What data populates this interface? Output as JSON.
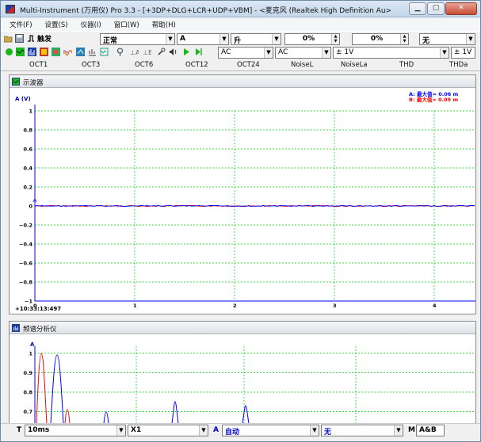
{
  "titlebar": {
    "title": "Multi-Instrument (万用仪) Pro 3.3   -   [+3DP+DLG+LCR+UDP+VBM]   -   <麦克风 (Realtek High Definition Au>"
  },
  "menu": [
    "文件(F)",
    "设置(S)",
    "仪器(I)",
    "窗口(W)",
    "帮助(H)"
  ],
  "toolbar1": {
    "trigger_label": "触发",
    "mode_value": "正常",
    "channel_value": "A",
    "edge_value": "升",
    "level_value": "0%",
    "position_value": "0%",
    "extra_value": "无"
  },
  "toolbar2": {
    "coupling_a": "AC",
    "coupling_b": "AC",
    "range_a": "± 1V",
    "range_b": "± 1V"
  },
  "octave_tabs": [
    "OCT1",
    "OCT3",
    "OCT6",
    "OCT12",
    "OCT24",
    "NoiseL",
    "NoiseLa",
    "THD",
    "THDa"
  ],
  "oscilloscope": {
    "title": "示波器",
    "y_axis_label": "A  (V)",
    "legend_a": "A:  最大值=     0.06  m",
    "legend_b": "B:  最大值=     0.09  m",
    "time_label": "+10:33:13:497",
    "y_ticks": [
      "1",
      "0.8",
      "0.6",
      "0.4",
      "0.2",
      "0",
      "−0.2",
      "−0.4",
      "−0.6",
      "−0.8",
      "−1"
    ],
    "x_ticks": [
      "0",
      "1",
      "2",
      "3",
      "4"
    ],
    "colors": {
      "grid": "#00cc00",
      "channel_a": "#0000ff",
      "channel_b": "#ff0000"
    }
  },
  "spectrum": {
    "title": "频谱分析仪",
    "y_axis_label": "A",
    "y_ticks": [
      "1",
      "0.9",
      "0.8",
      "0.7"
    ]
  },
  "bottom_bar": {
    "t_label": "T",
    "timebase_value": "10ms",
    "zoom_value": "X1",
    "a_label": "A",
    "a_value": "自动",
    "b_value": "无",
    "m_label": "M",
    "m_value": "A&B"
  }
}
